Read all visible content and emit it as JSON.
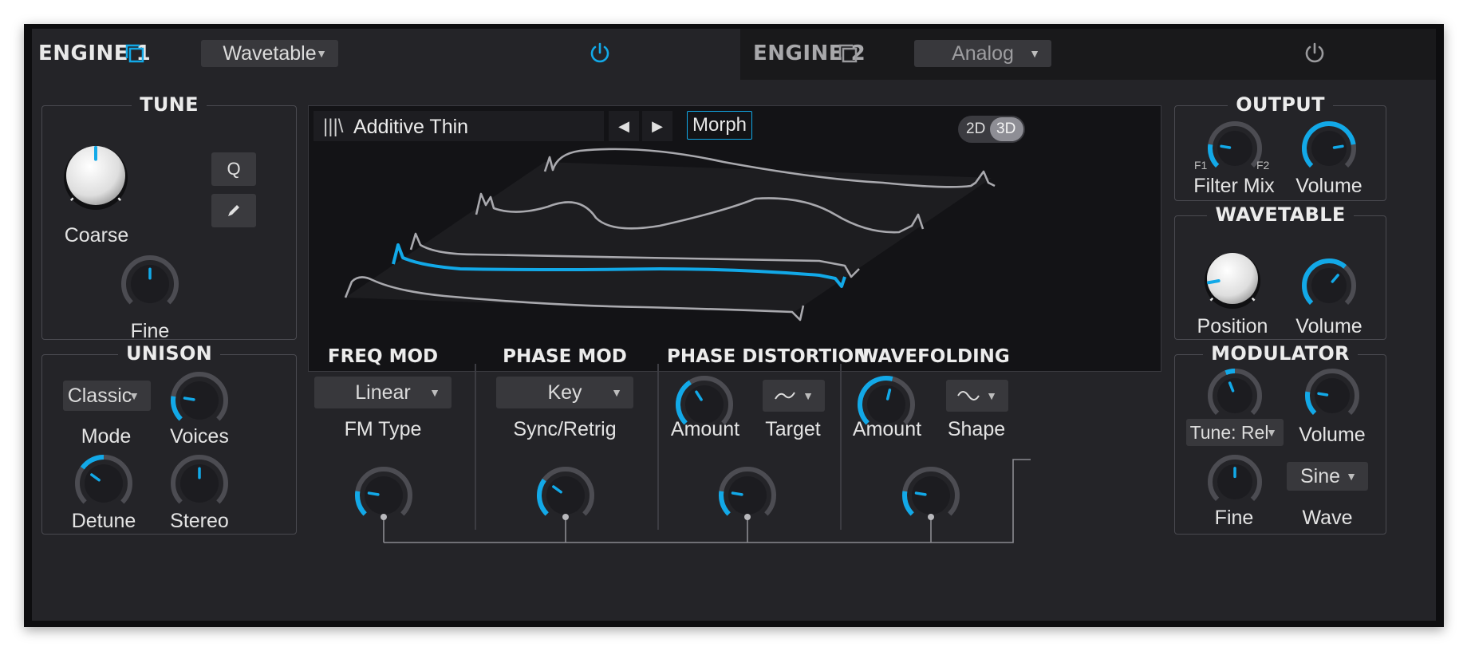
{
  "engine1": {
    "title": "ENGINE 1",
    "type": "Wavetable"
  },
  "engine2": {
    "title": "ENGINE 2",
    "type": "Analog"
  },
  "tune": {
    "title": "TUNE",
    "coarse_label": "Coarse",
    "fine_label": "Fine",
    "q_label": "Q"
  },
  "unison": {
    "title": "UNISON",
    "mode_value": "Classic",
    "mode_label": "Mode",
    "voices_label": "Voices",
    "detune_label": "Detune",
    "stereo_label": "Stereo"
  },
  "wavetable_display": {
    "icon_text": "|||\\",
    "name": "Additive Thin",
    "morph_label": "Morph",
    "view_2d": "2D",
    "view_3d": "3D",
    "active_view": "3D"
  },
  "freq_mod": {
    "title": "FREQ MOD",
    "type_value": "Linear",
    "type_label": "FM Type"
  },
  "phase_mod": {
    "title": "PHASE MOD",
    "sync_value": "Key",
    "sync_label": "Sync/Retrig"
  },
  "phase_distortion": {
    "title": "PHASE DISTORTION",
    "amount_label": "Amount",
    "target_label": "Target"
  },
  "wavefolding": {
    "title": "WAVEFOLDING",
    "amount_label": "Amount",
    "shape_label": "Shape"
  },
  "output": {
    "title": "OUTPUT",
    "filter_mix_label": "Filter Mix",
    "f1_label": "F1",
    "f2_label": "F2",
    "volume_label": "Volume"
  },
  "wavetable": {
    "title": "WAVETABLE",
    "position_label": "Position",
    "volume_label": "Volume"
  },
  "modulator": {
    "title": "MODULATOR",
    "tune_value": "Tune: Rel",
    "volume_label": "Volume",
    "fine_label": "Fine",
    "wave_value": "Sine",
    "wave_label": "Wave"
  },
  "colors": {
    "accent": "#12a9e8",
    "panel": "#242428",
    "control": "#38383c",
    "text": "#e4e4e4"
  },
  "knob_values": {
    "fine": 0.5,
    "voices": 0.2,
    "detune": 0.3,
    "stereo": 0.5,
    "fm_amount": 0.2,
    "pm_amount": 0.3,
    "pd_amount": 0.38,
    "pd_mod": 0.2,
    "wf_amount": 0.55,
    "wf_mod": 0.2,
    "filter_mix": 0.2,
    "out_volume": 0.8,
    "wt_volume": 0.65,
    "mod_tune": 0.42,
    "mod_volume": 0.2,
    "mod_fine": 0.5
  }
}
